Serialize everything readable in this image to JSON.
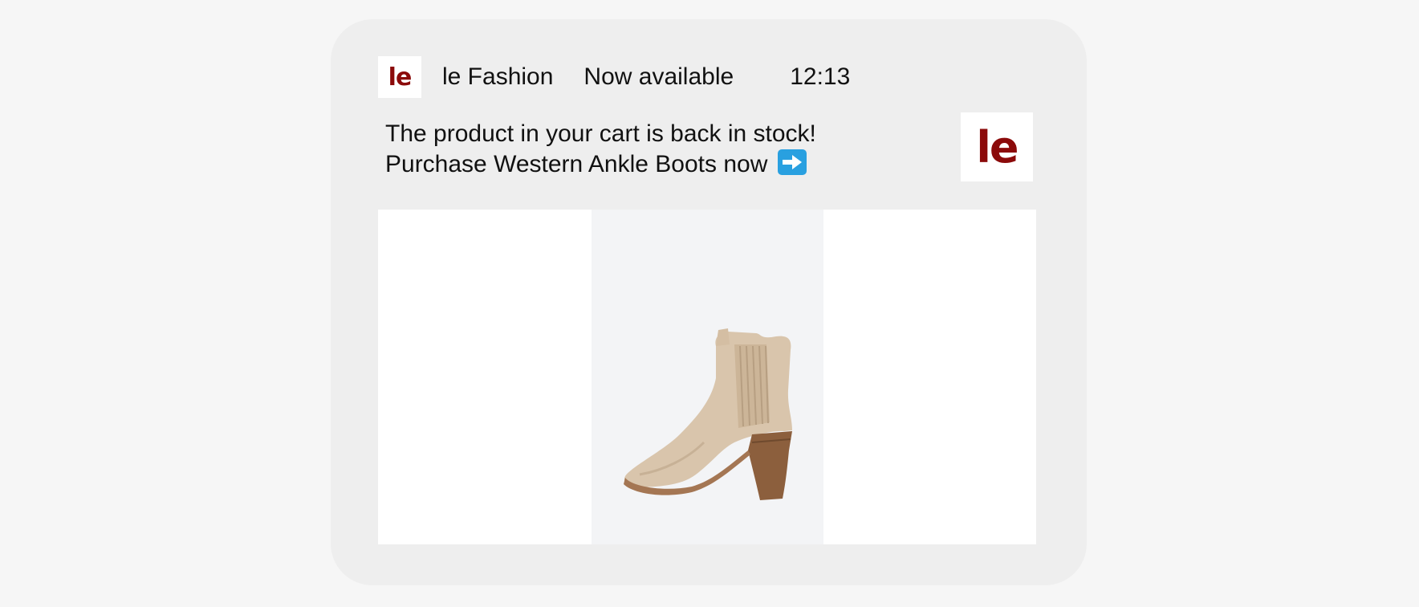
{
  "notification": {
    "app_icon_text": "le",
    "app_name": "le Fashion",
    "status": "Now available",
    "time": "12:13",
    "message_line1": "The product in your cart is back in stock!",
    "message_line2": "Purchase Western Ankle Boots now",
    "arrow_icon": "right-arrow-emoji",
    "thumbnail_logo_text": "le"
  },
  "colors": {
    "brand": "#8b0a0a",
    "card_background": "#eeeeee",
    "arrow_emoji": "#29a0e0"
  },
  "product_image": {
    "icon": "ankle-boot-photo"
  }
}
